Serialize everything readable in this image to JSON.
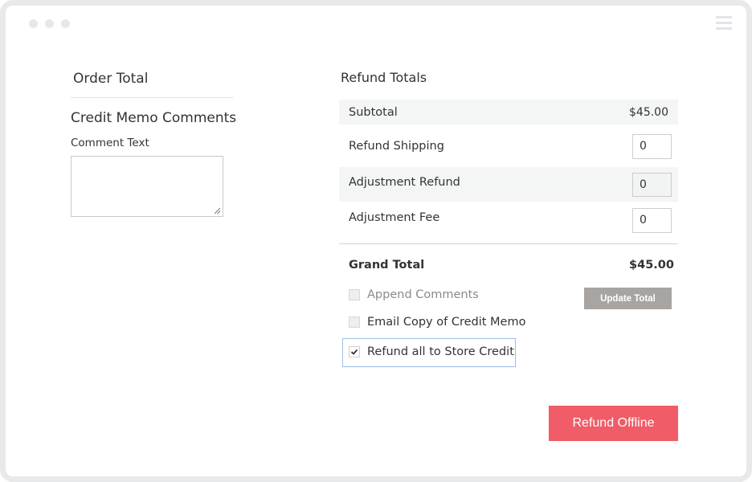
{
  "window": {
    "dots": [
      "dot",
      "dot",
      "dot"
    ],
    "menu_icon": "hamburger-menu-icon"
  },
  "left": {
    "order_total_title": "Order Total",
    "credit_memo_comments_title": "Credit Memo Comments",
    "comment_text_label": "Comment Text",
    "comment_text_value": ""
  },
  "refund_totals": {
    "title": "Refund Totals",
    "rows": [
      {
        "label": "Subtotal",
        "value": "$45.00"
      },
      {
        "label": "Refund Shipping",
        "value": "0"
      },
      {
        "label": "Adjustment Refund",
        "value": "0"
      },
      {
        "label": "Adjustment Fee",
        "value": "0"
      }
    ],
    "grand_total_label": "Grand Total",
    "grand_total_value": "$45.00"
  },
  "options": {
    "append_comments": {
      "label": "Append Comments",
      "checked": false,
      "disabled": true
    },
    "email_copy": {
      "label": "Email Copy of Credit Memo",
      "checked": false
    },
    "refund_store_credit": {
      "label": "Refund all to Store Credit",
      "checked": true
    }
  },
  "buttons": {
    "update_total": "Update Total",
    "refund_offline": "Refund Offline"
  },
  "colors": {
    "refund_button": "#f05c67",
    "update_button": "#a8a4a2",
    "focus_border": "#9cbde6"
  }
}
